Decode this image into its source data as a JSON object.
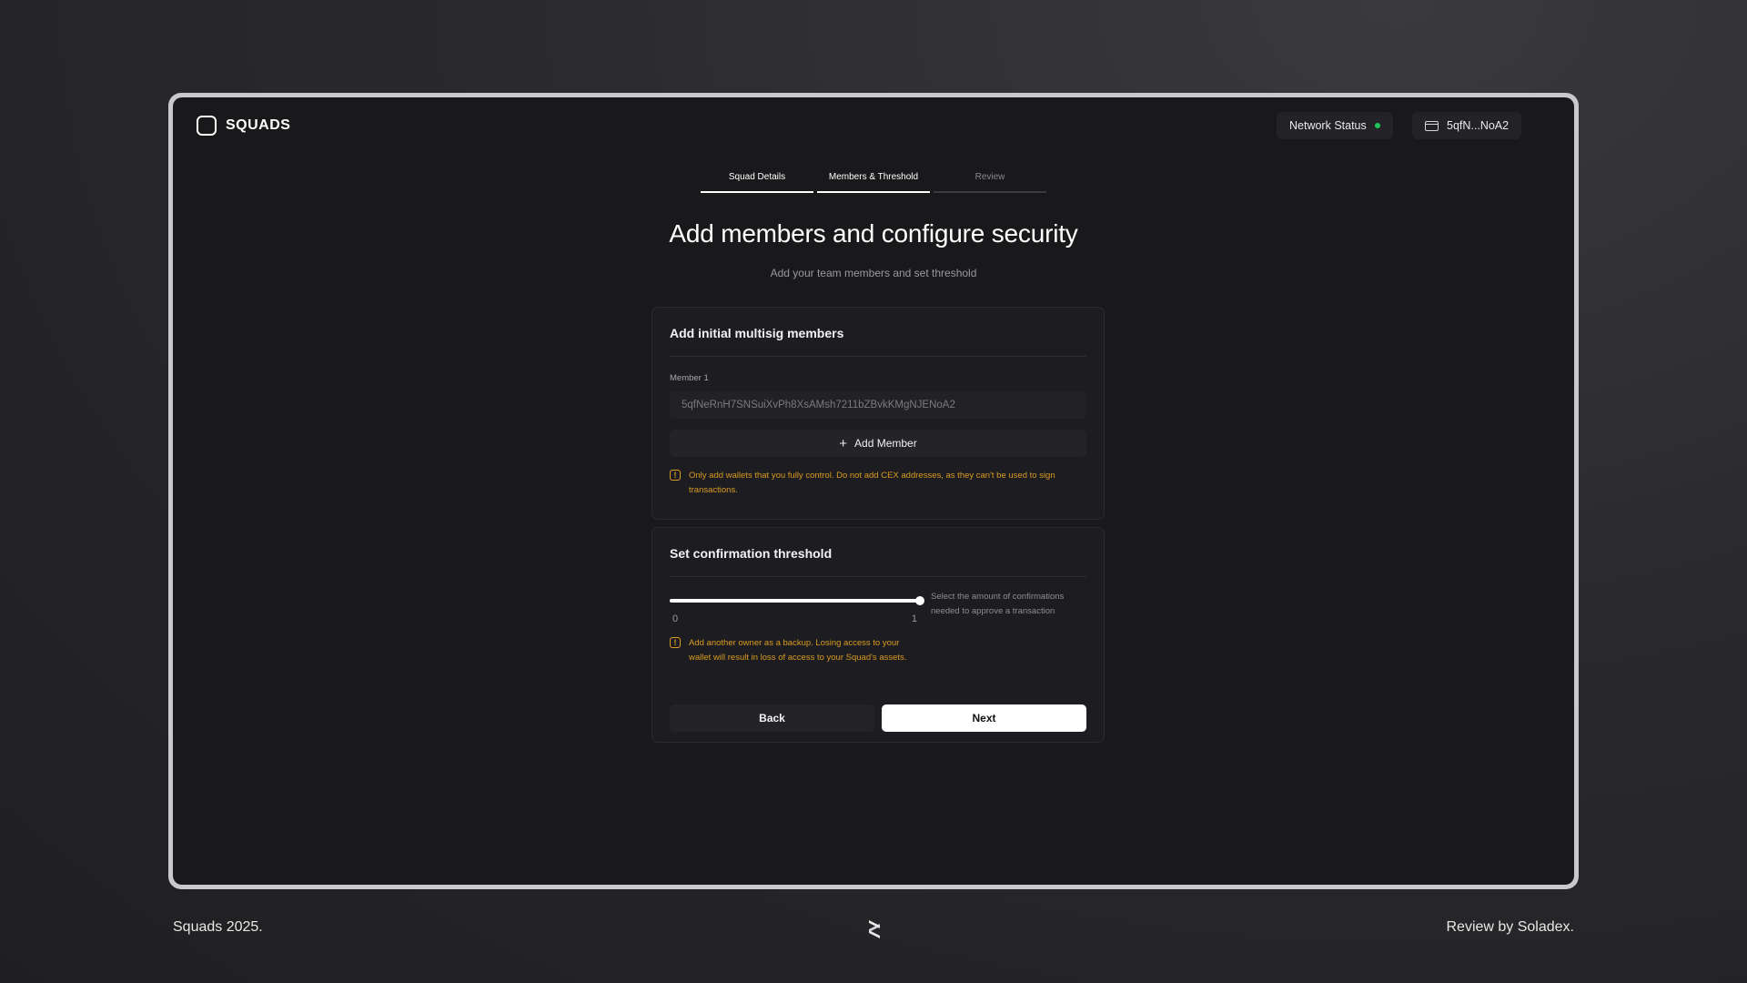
{
  "app": {
    "logo_text": "SQUADS",
    "network_status_label": "Network Status",
    "network_status_color": "#21c25e",
    "wallet_short": "5qfN...NoA2"
  },
  "steps": [
    {
      "label": "Squad Details",
      "state": "complete"
    },
    {
      "label": "Members & Threshold",
      "state": "active"
    },
    {
      "label": "Review",
      "state": "pending"
    }
  ],
  "heading": {
    "title": "Add members and configure security",
    "subtitle": "Add your team members and set threshold"
  },
  "members_card": {
    "title": "Add initial multisig members",
    "member_label": "Member 1",
    "member_value": "5qfNeRnH7SNSuiXvPh8XsAMsh7211bZBvkKMgNJENoA2",
    "add_member_label": "Add Member",
    "warning": "Only add wallets that you fully control. Do not add CEX addresses, as they can't be used to sign transactions.",
    "warning_color": "#d99b21"
  },
  "threshold_card": {
    "title": "Set confirmation threshold",
    "min": "0",
    "max": "1",
    "value_fraction": 1.0,
    "help": "Select the amount of confirmations needed to approve a transaction",
    "warning": "Add another owner as a backup. Losing access to your wallet will result in loss of access to your Squad's assets.",
    "back_label": "Back",
    "next_label": "Next"
  },
  "footer": {
    "left": "Squads 2025.",
    "right": "Review by Soladex."
  }
}
